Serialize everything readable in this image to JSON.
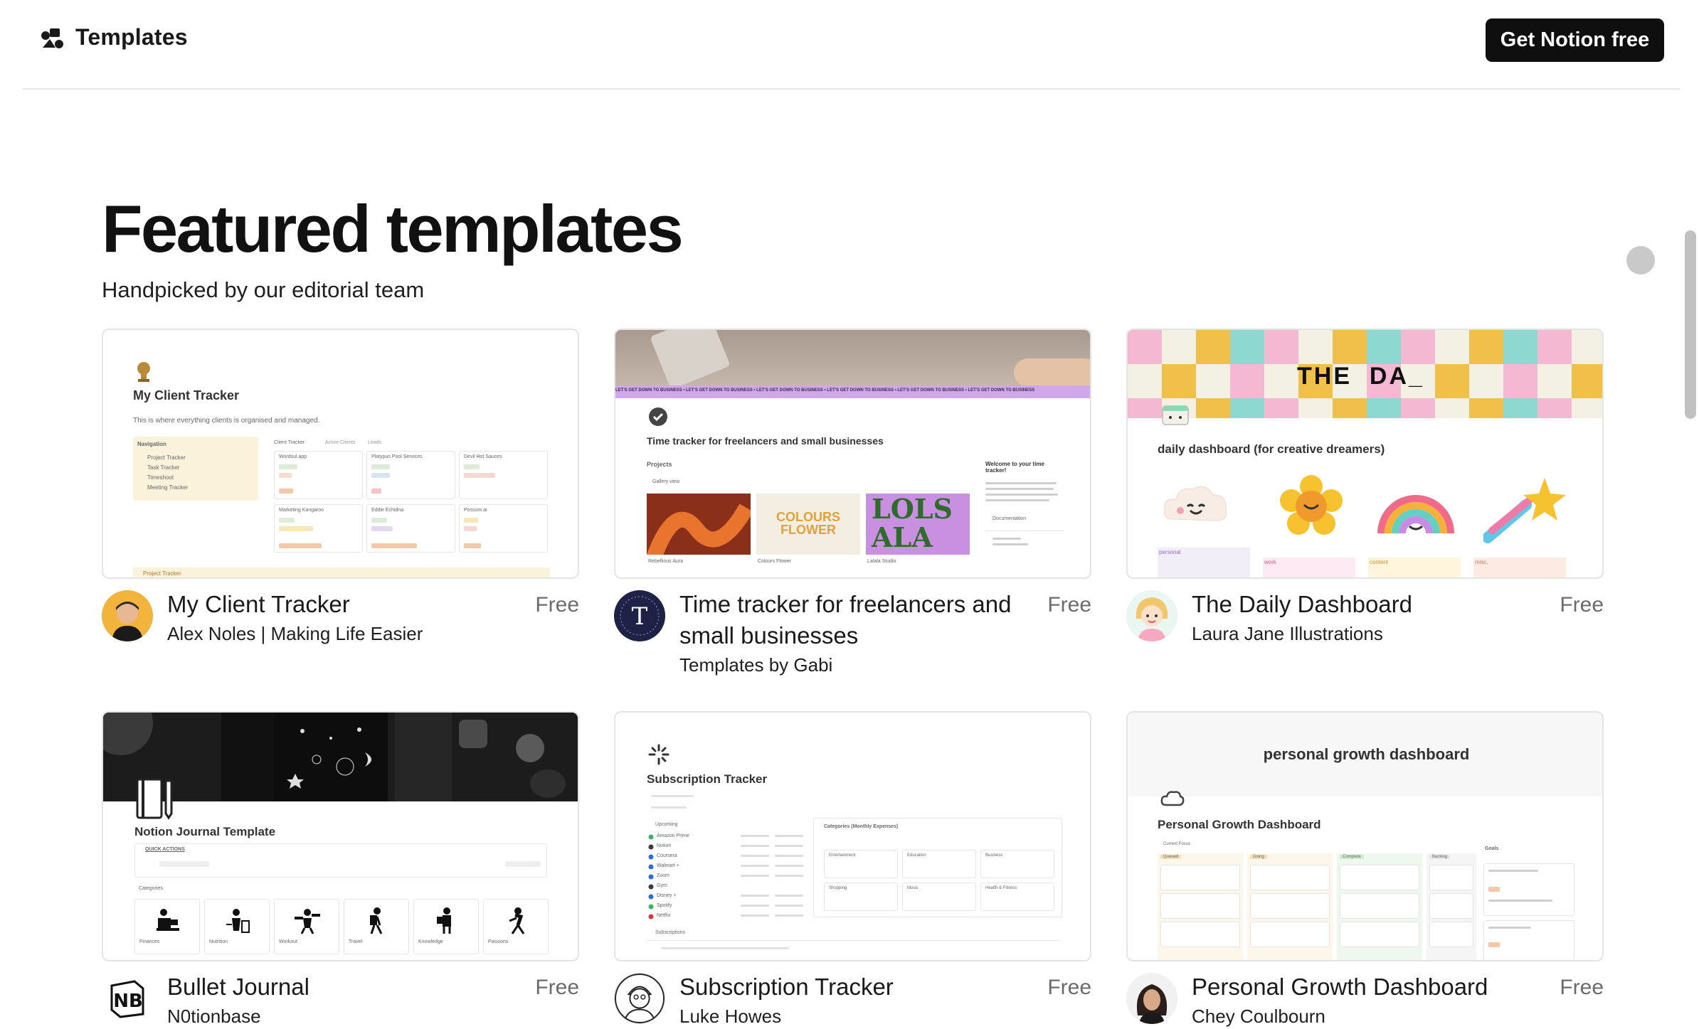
{
  "header": {
    "brand_label": "Templates",
    "cta_label": "Get Notion free"
  },
  "main": {
    "title": "Featured templates",
    "subtitle": "Handpicked by our editorial team"
  },
  "cards": [
    {
      "name": "My Client Tracker",
      "author": "Alex Noles | Making Life Easier",
      "price": "Free",
      "preview": {
        "title": "My Client Tracker",
        "description": "This is where everything clients is organised and managed.",
        "nav_title": "Navigation",
        "nav_items": [
          "Project Tracker",
          "Task Tracker",
          "Timeshoot",
          "Meeting Tracker"
        ],
        "tabs": [
          "Client Tracker",
          "Active Clients",
          "Leads"
        ],
        "clients": [
          "Wordsul.app",
          "Platypus Pool Services",
          "Devil Hot Sauces",
          "Marketing Kangaroo",
          "Eddie Echidna",
          "Possum.ai"
        ],
        "footer": "Project Tracker"
      }
    },
    {
      "name": "Time tracker for freelancers and small businesses",
      "author": "Templates by Gabi",
      "price": "Free",
      "preview": {
        "ticker": "LET'S GET DOWN TO BUSINESS • LET'S GET DOWN TO BUSINESS • LET'S GET DOWN TO BUSINESS • LET'S GET DOWN TO BUSINESS • LET'S GET DOWN TO BUSINESS • LET'S GET DOWN TO BUSINESS",
        "title": "Time tracker for freelancers and small businesses",
        "section": "Projects",
        "view": "Gallery view",
        "tile_text_1": "COLOURS FLOWER",
        "tile_text_2": "LOLS ALA",
        "welcome": "Welcome to your time tracker!",
        "doc_label": "Documentation",
        "projects": [
          "Rebellious Aura",
          "Colours Flower",
          "Lalala Studio"
        ]
      }
    },
    {
      "name": "The Daily Dashboard",
      "author": "Laura Jane Illustrations",
      "price": "Free",
      "preview": {
        "banner_text": "THE  DA_",
        "title": "daily dashboard (for creative dreamers)",
        "tags": [
          "personal",
          "work",
          "content",
          "misc."
        ]
      }
    },
    {
      "name": "Bullet Journal",
      "author": "N0tionbase",
      "price": "Free",
      "preview": {
        "title": "Notion Journal Template",
        "quick_actions": "QUICK ACTIONS",
        "categories_label": "Categories",
        "categories": [
          "Finances",
          "Nutrition",
          "Workout",
          "Travel",
          "Knowledge",
          "Passions"
        ]
      }
    },
    {
      "name": "Subscription Tracker",
      "author": "Luke Howes",
      "price": "Free",
      "preview": {
        "title": "Subscription Tracker",
        "upcoming": "Upcoming",
        "services": [
          "Amazon Prime",
          "Notion",
          "Coursera",
          "Walmart +",
          "Zoom",
          "Gym",
          "Disney +",
          "Spotify",
          "Netflix"
        ],
        "categories_title": "Categories (Monthly Expenses)",
        "categories": [
          "Entertainment",
          "Education",
          "Business",
          "Shopping",
          "Music",
          "Health & Fitness"
        ],
        "subscriptions": "Subscriptions"
      }
    },
    {
      "name": "Personal Growth Dashboard",
      "author": "Chey Coulbourn",
      "price": "Free",
      "preview": {
        "banner_text": "personal growth dashboard",
        "title": "Personal Growth Dashboard",
        "focus_label": "Current Focus",
        "columns": [
          "Queued",
          "Doing",
          "Complete",
          "Backlog"
        ],
        "goals_label": "Goals"
      }
    }
  ]
}
